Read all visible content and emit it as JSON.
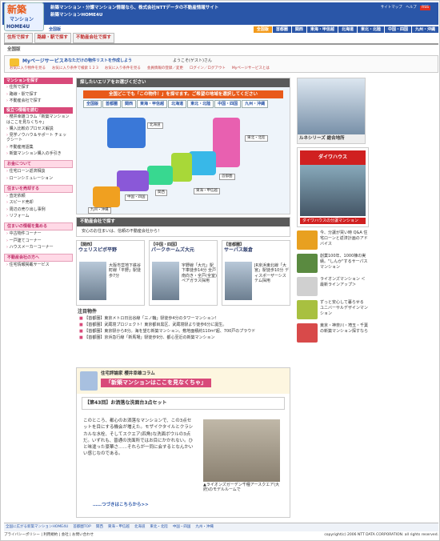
{
  "header": {
    "logo_top": "新築",
    "logo_small": "マンション",
    "logo_bottom": "HOME4U",
    "tagline": "新築マンション・分譲マンション情報なら、株式会社NTTデータの不動産情報サイト",
    "tagline2": "新築マンションHOME4U",
    "links": [
      "サイトマップ",
      "ヘルプ"
    ],
    "rss": "RSS"
  },
  "region": {
    "label": "全国版",
    "tabs": [
      "全国版",
      "首都圏",
      "関西",
      "東海・甲信越",
      "北海道",
      "東北・北陸",
      "中国・四国",
      "九州・沖縄"
    ]
  },
  "nav": [
    "住所で探す",
    "路線・駅で探す",
    "不動産会社で探す"
  ],
  "breadcrumb": "全国版",
  "mypage": {
    "title": "Myページサービス",
    "subtitle": "あなただけの物件リストを作成しよう",
    "welcome": "ようこそ(ゲスト)さん",
    "links": [
      "お気に入り物件を見る",
      "お気に入り条件で検索 1 2 3",
      "お気に入り条件を見る",
      "会員情報の登録／変更",
      "ログイン／ログアウト",
      "Myページサービスとは"
    ]
  },
  "sidebar": {
    "blocks": [
      {
        "head": "マンションを探す",
        "items": [
          "住所で探す",
          "路線・駅で探す",
          "不動産会社で探す"
        ]
      },
      {
        "head": "役立つ情報を読む",
        "items": [
          "櫻井幸雄コラム「新築マンションはここを見なくちゃ」",
          "購入比較のプロセス解説",
          "見学ノウハウ＆サポート チェックシート",
          "不動産用語集",
          "新築マンション購入の手引き"
        ]
      },
      {
        "head": "お金について",
        "items": [
          "住宅ローン返済相談",
          "ローンシミュレーション"
        ]
      },
      {
        "head": "住まいを売却する",
        "items": [
          "査定依頼",
          "スピード売却",
          "周辺の売り出し事例",
          "リフォーム"
        ]
      },
      {
        "head": "住まいの情報を集める",
        "items": [
          "中古物件コーナー",
          "一戸建てコーナー",
          "ハウスメーカーコーナー"
        ]
      },
      {
        "head": "不動産会社の方へ",
        "items": [
          "住宅情報掲載サービス"
        ]
      }
    ]
  },
  "map": {
    "header": "探したいエリアをお選びください",
    "title": "全国どこでも「この物件！」を探せます。ご希望の地域を選択してください",
    "tabs": [
      "全国版",
      "首都圏",
      "関西",
      "東海・甲信越",
      "北海道",
      "東北・北陸",
      "中国・四国",
      "九州・沖縄"
    ],
    "labels": [
      "北海道",
      "東北・北陸",
      "首都圏",
      "東海・甲信越",
      "関西",
      "中国・四国",
      "九州・沖縄"
    ],
    "colors": {
      "hokkaido": "#3a78d8",
      "tohoku": "#e860b0",
      "shutoken": "#38b8e8",
      "tokai": "#a8d838",
      "kansai": "#38d890",
      "chugoku": "#8a58d8",
      "kyushu": "#f0a020"
    }
  },
  "company": {
    "header": "不動産会社で探す",
    "note": "安心のお住まいは、信頼の不動産会社から！"
  },
  "properties": [
    {
      "region": "【関西】",
      "name": "ウェリスピボ平野",
      "desc": "大阪市営地下鉄谷町線「平野」駅徒歩7分"
    },
    {
      "region": "【中国・四国】",
      "name": "パークホームズ大元",
      "desc": "宇野線「大元」駅下車徒歩14分 全戸南向き・全戸(全室)ペアガラス採用"
    },
    {
      "region": "【首都圏】",
      "name": "サーパス飯倉",
      "desc": "JR京浜東北線「大宮」駅徒歩10分 ディスポーザーシステム採用"
    }
  ],
  "news": {
    "title": "注目物件",
    "items": [
      "【首都圏】東京メトロ日比谷線「三ノ輪」駅徒歩4分のタワーマンション！",
      "【首都圏】武蔵境プロジェクト！東京都目黒区、武蔵境駅より徒歩6分に誕生。",
      "【首都圏】東京駅から8分。海を望む新築マンション。敷地面積約110ｍ²超、700戸のプラウド",
      "【首都圏】京浜急行線「新馬場」駅徒歩9分、都心至近の新築マンション"
    ]
  },
  "column": {
    "author": "住宅評論家 櫻井幸雄コラム",
    "title": "「新築マンションはここを見なくちゃ」",
    "episode": "【第43回】お洒落な洗面台3点セット",
    "body": "このところ、都心のお洒落なマンションで、この3点セットを目にする機会が増えた。モザイクタイルとクラシカルな水栓、そしてスクエア(四角)な洗面ボウルの3点だ。いずれも、普通の洗面所ではお目にかかれない。ひと味違った豪華さ……それらが一同に会するとなんかいい感じなのである。",
    "caption": "▲ライオンズガーデン千種アースクエア(大府)のモデルルームで",
    "more": "……つづきはこちらから>>"
  },
  "right": {
    "ad1": {
      "label": "ルネシリーズ",
      "tag": "総合地所"
    },
    "ad2": {
      "logo": "ダイワハウス",
      "caption": "ダイワハウスの分譲マンション"
    },
    "links": [
      {
        "text": "今、分譲が買い時 Q&A 住宅ローンと返済計画のアドバイス",
        "color": "#e8a020"
      },
      {
        "text": "創業100年、1000棟の実績。\"しんか\"するサーパスマンション",
        "color": "#5a8a40"
      },
      {
        "text": "ライオンズマンション ＜最新ラインアップ＞",
        "color": "#d0d0d0"
      },
      {
        "text": "ずっと安心して暮らせる ユニバーサルデザインマンション",
        "color": "#a8c040"
      },
      {
        "text": "東京・神奈川・埼玉・千葉の新築マンション探すなら",
        "color": "#d84a4a"
      }
    ]
  },
  "footer": {
    "label": "全国に広がる新築マンションHOME4U",
    "nav": [
      "首都圏TOP",
      "関西",
      "東海・甲信越",
      "北海道",
      "東北・北陸",
      "中国・四国",
      "九州・沖縄"
    ],
    "bottom": [
      "プライバシーポリシー",
      "利用規約",
      "会社",
      "お問い合わせ"
    ],
    "copyright": "copyright(c) 2006 NTT DATA CORPORATION. all rights reserved."
  }
}
